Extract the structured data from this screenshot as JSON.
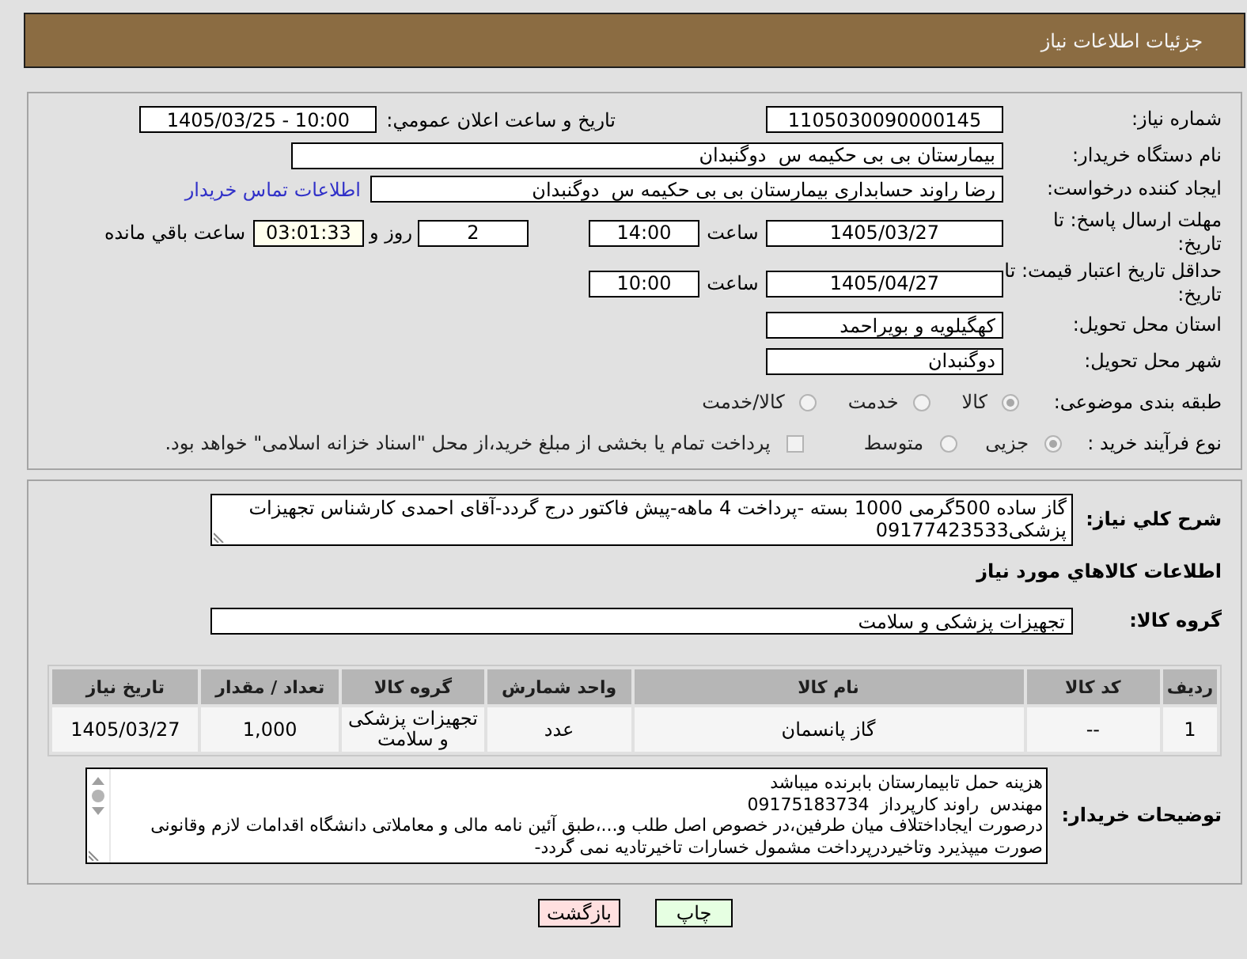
{
  "page": {
    "title": "جزئیات اطلاعات نیاز"
  },
  "details": {
    "need_number": {
      "label": "شماره نیاز:",
      "value": "1105030090000145"
    },
    "announcement": {
      "label": "تاريخ و ساعت اعلان عمومي:",
      "value": "1405/03/25 - 10:00"
    },
    "buyer_org": {
      "label": "نام دستگاه خریدار:",
      "value": "بیمارستان بی بی حکیمه س  دوگنبدان"
    },
    "requester": {
      "label": "ایجاد کننده درخواست:",
      "value": "رضا راوند حسابداری بیمارستان بی بی حکیمه س  دوگنبدان",
      "link": "اطلاعات تماس خریدار"
    },
    "reply_deadline": {
      "label": "مهلت ارسال پاسخ: تا تاریخ:",
      "date": "1405/03/27",
      "time_label": "ساعت",
      "time": "14:00",
      "days": "2",
      "days_label": "روز و",
      "remaining": "03:01:33",
      "remaining_label": "ساعت باقي مانده"
    },
    "price_validity": {
      "label": "حداقل تاریخ اعتبار قیمت: تا تاریخ:",
      "date": "1405/04/27",
      "time_label": "ساعت",
      "time": "10:00"
    },
    "delivery_province": {
      "label": "استان محل تحویل:",
      "value": "کهگیلویه و بویراحمد"
    },
    "delivery_city": {
      "label": "شهر محل تحویل:",
      "value": "دوگنبدان"
    },
    "category": {
      "label": "طبقه بندی موضوعی:",
      "options": [
        {
          "label": "کالا",
          "selected": true
        },
        {
          "label": "خدمت",
          "selected": false
        },
        {
          "label": "کالا/خدمت",
          "selected": false
        }
      ]
    },
    "process_type": {
      "label": "نوع فرآیند خرید :",
      "options": [
        {
          "label": "جزیی",
          "selected": true
        },
        {
          "label": "متوسط",
          "selected": false
        }
      ],
      "treasury": {
        "label": "پرداخت تمام یا بخشی از مبلغ خرید،از محل \"اسناد خزانه اسلامی\" خواهد بود.",
        "checked": false
      }
    }
  },
  "need": {
    "description": {
      "label": "شرح کلي نیاز:",
      "value": "گاز ساده 500گرمی 1000 بسته -پرداخت 4 ماهه-پیش فاکتور درج گردد-آقای احمدی کارشناس تجهیزات پزشکی09177423533"
    },
    "goods_heading": "اطلاعات کالاهاي مورد نياز",
    "goods_group": {
      "label": "گروه کالا:",
      "value": "تجهیزات پزشکی و سلامت"
    },
    "table": {
      "columns": [
        "ردیف",
        "کد کالا",
        "نام کالا",
        "واحد شمارش",
        "گروه کالا",
        "تعداد / مقدار",
        "تاریخ نیاز"
      ],
      "rows": [
        [
          "1",
          "--",
          "گاز پانسمان",
          "عدد",
          "تجهیزات پزشکی و سلامت",
          "1,000",
          "1405/03/27"
        ]
      ]
    },
    "buyer_notes": {
      "label": "توضیحات خریدار:",
      "lines": [
        "هزینه حمل تابیمارستان بابرنده میباشد",
        "مهندس  راوند کارپرداز  09175183734",
        "درصورت ایجاداختلاف میان طرفین،در خصوص اصل طلب و...،طبق آئین نامه مالی و معاملاتی دانشگاه اقدامات لازم وقانونی",
        "صورت میپذیرد وتاخیردرپرداخت مشمول خسارات تاخیرتادیه نمی گردد-"
      ]
    }
  },
  "buttons": [
    {
      "label": "چاپ",
      "kind": "print"
    },
    {
      "label": "بازگشت",
      "kind": "back"
    }
  ]
}
